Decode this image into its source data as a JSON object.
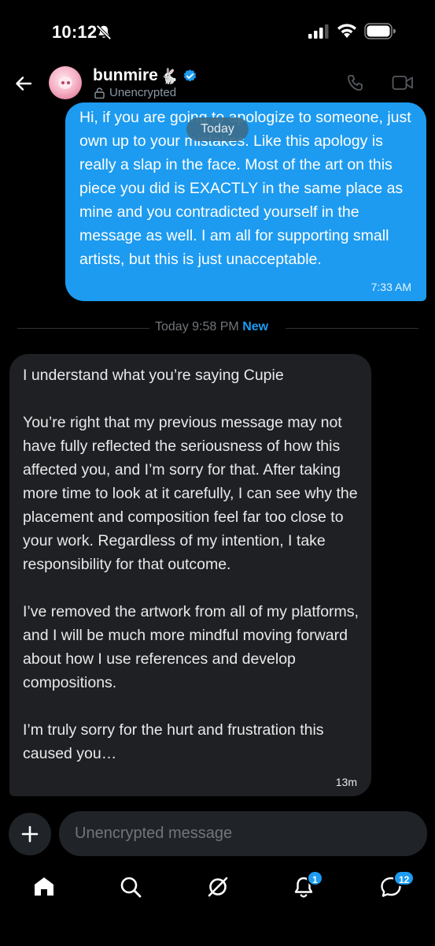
{
  "status_bar": {
    "time": "10:12"
  },
  "header": {
    "name": "bunmire",
    "name_emoji": "🐇",
    "encryption": "Unencrypted"
  },
  "messages": {
    "outgoing": {
      "text": "Hi, if you are going to apologize to someone, just own up to your mistakes. Like this apology is really a slap in the face. Most of the art on this piece you did is EXACTLY in the same place as mine and you contradicted yourself in the message as well. I am all for supporting small artists, but this is just unacceptable.",
      "time": "7:33 AM"
    },
    "date_pill": "Today",
    "divider": {
      "label": "Today 9:58 PM",
      "new_label": "New"
    },
    "incoming": {
      "paragraphs": [
        "I understand what you’re saying Cupie",
        "You’re right that my previous message may not have fully reflected the seriousness of how this affected you, and I’m sorry for that. After taking more time to look at it carefully, I can see why the placement and composition feel far too close to your work. Regardless of my intention, I take responsibility for that outcome.",
        "I’ve removed the artwork from all of my platforms, and I will be much more mindful moving forward about how I use references and develop compositions.",
        "I’m truly sorry for the hurt and frustration this caused you…"
      ],
      "time": "13m"
    }
  },
  "composer": {
    "placeholder": "Unencrypted message"
  },
  "nav": {
    "items": [
      "home-icon",
      "search-icon",
      "grok-icon",
      "notifications-icon",
      "messages-icon"
    ],
    "notifications_badge": "1",
    "messages_badge": "12"
  },
  "colors": {
    "accent": "#1d9bf0",
    "bubble_in": "#1f2023",
    "background": "#000000"
  }
}
